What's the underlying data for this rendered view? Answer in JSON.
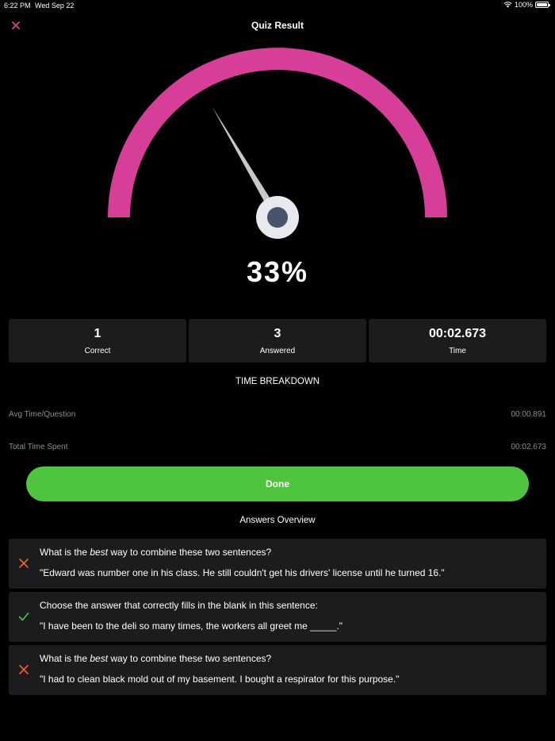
{
  "status_bar": {
    "time": "6:22 PM",
    "date": "Wed Sep 22",
    "battery": "100%"
  },
  "header": {
    "title": "Quiz Result"
  },
  "gauge": {
    "value_fraction": 0.33,
    "color": "#d63e9a"
  },
  "score": {
    "percent_text": "33%"
  },
  "stats": [
    {
      "value": "1",
      "label": "Correct"
    },
    {
      "value": "3",
      "label": "Answered"
    },
    {
      "value": "00:02.673",
      "label": "Time"
    }
  ],
  "time_breakdown": {
    "title": "TIME BREAKDOWN",
    "rows": [
      {
        "label": "Avg Time/Question",
        "value": "00:00.891"
      },
      {
        "label": "Total Time Spent",
        "value": "00:02.673"
      }
    ]
  },
  "done_button": {
    "label": "Done",
    "color": "#4fc43f"
  },
  "answers_overview": {
    "title": "Answers Overview",
    "items": [
      {
        "status": "incorrect",
        "q_pre": "What is the ",
        "q_em": "best",
        "q_post": " way to combine these two sentences?",
        "sentence": "\"Edward was number one in his class. He still couldn't get his drivers' license until he turned 16.\""
      },
      {
        "status": "correct",
        "q_pre": "Choose the answer that correctly fills in the blank in this sentence:",
        "q_em": "",
        "q_post": "",
        "sentence": "\"I have been to the deli so many times, the workers all greet me _____.\""
      },
      {
        "status": "incorrect",
        "q_pre": "What is the ",
        "q_em": "best",
        "q_post": " way to combine these two sentences?",
        "sentence": "\"I had to clean black mold out of my basement. I bought a respirator for this purpose.\""
      }
    ]
  },
  "colors": {
    "incorrect": "#f0612e",
    "correct": "#4fc43f",
    "card_bg": "#1c1c1e"
  }
}
